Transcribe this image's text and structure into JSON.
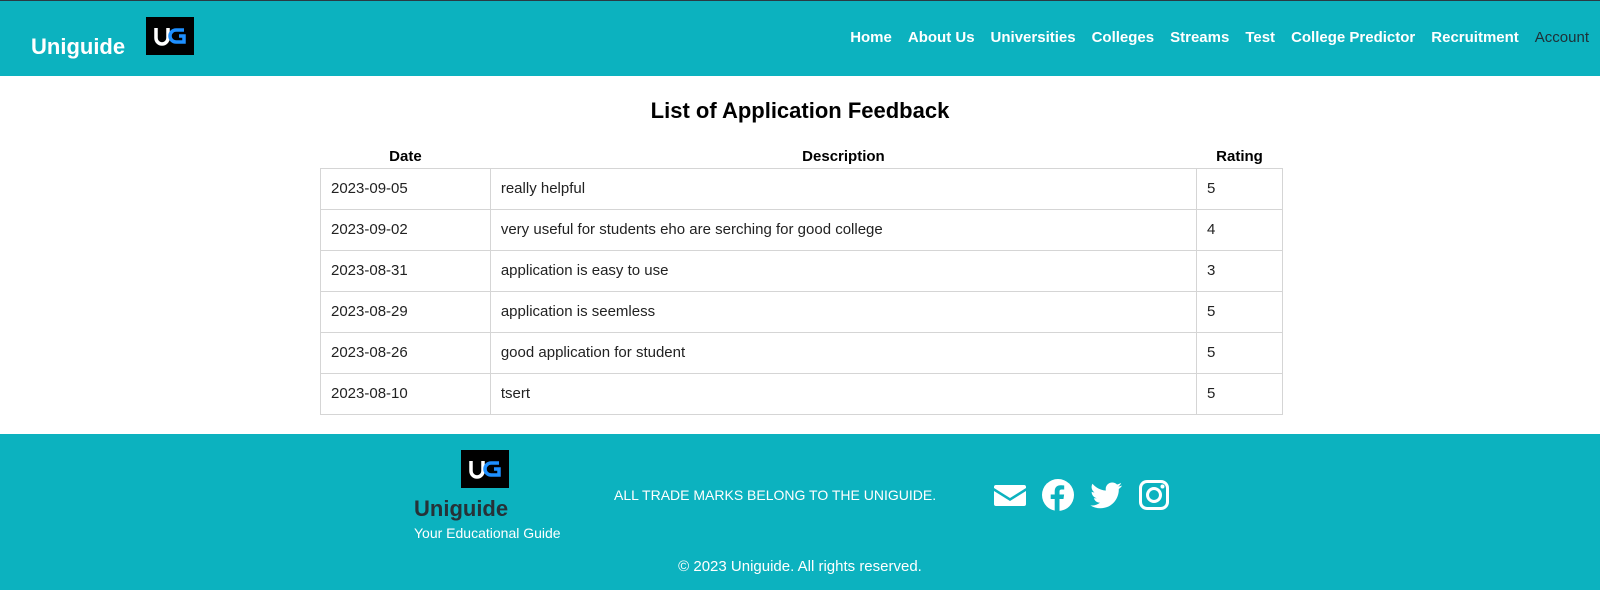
{
  "header": {
    "brand": "Uniguide",
    "logo_text": "UG",
    "nav": [
      {
        "label": "Home"
      },
      {
        "label": "About Us"
      },
      {
        "label": "Universities"
      },
      {
        "label": "Colleges"
      },
      {
        "label": "Streams"
      },
      {
        "label": "Test"
      },
      {
        "label": "College Predictor"
      },
      {
        "label": "Recruitment"
      },
      {
        "label": "Account"
      }
    ]
  },
  "main": {
    "title": "List of Application Feedback",
    "columns": [
      "Date",
      "Description",
      "Rating"
    ],
    "rows": [
      {
        "date": "2023-09-05",
        "description": "really helpful",
        "rating": "5"
      },
      {
        "date": "2023-09-02",
        "description": "very useful for students eho are serching for good college",
        "rating": "4"
      },
      {
        "date": "2023-08-31",
        "description": "application is easy to use",
        "rating": "3"
      },
      {
        "date": "2023-08-29",
        "description": "application is seemless",
        "rating": "5"
      },
      {
        "date": "2023-08-26",
        "description": "good application for student",
        "rating": "5"
      },
      {
        "date": "2023-08-10",
        "description": "tsert",
        "rating": "5"
      }
    ]
  },
  "footer": {
    "brand": "Uniguide",
    "tagline": "Your Educational Guide",
    "trademark": "ALL TRADE MARKS BELONG TO THE UNIGUIDE.",
    "copyright": "© 2023 Uniguide. All rights reserved.",
    "social_icons": [
      "envelope-icon",
      "facebook-icon",
      "twitter-icon",
      "instagram-icon"
    ]
  },
  "colors": {
    "brand_teal": "#0cb2bf",
    "text_dark": "#263238",
    "white": "#ffffff"
  }
}
